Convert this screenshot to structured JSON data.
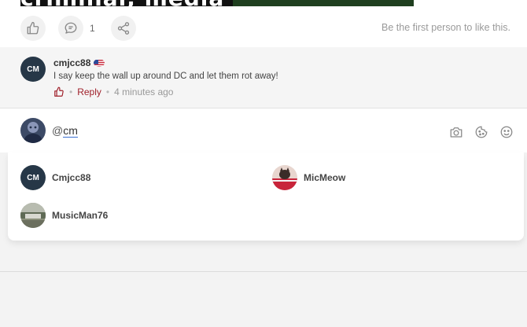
{
  "hero": {
    "banner_text": "criminal, media"
  },
  "actions": {
    "comment_count": "1",
    "like_status": "Be the first person to like this."
  },
  "comment": {
    "avatar_initials": "CM",
    "author": "cmjcc88",
    "text": "I say keep the wall up around DC and let them rot away!",
    "reply_label": "Reply",
    "timestamp": "4 minutes ago",
    "accent_color": "#a0202a"
  },
  "compose": {
    "prefix": "@",
    "mention_text": "cm"
  },
  "mentions": [
    {
      "name": "Cmjcc88",
      "initials": "CM"
    },
    {
      "name": "MicMeow"
    },
    {
      "name": "MusicMan76"
    }
  ]
}
